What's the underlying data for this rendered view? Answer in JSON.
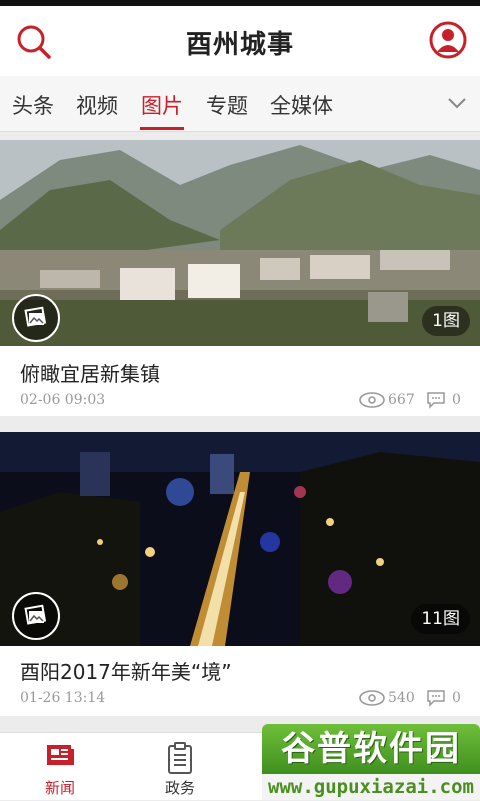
{
  "header": {
    "title": "酉州城事"
  },
  "tabs": [
    {
      "label": "头条"
    },
    {
      "label": "视频"
    },
    {
      "label": "图片"
    },
    {
      "label": "专题"
    },
    {
      "label": "全媒体"
    }
  ],
  "active_tab": "图片",
  "colors": {
    "accent": "#c8202a"
  },
  "cards": [
    {
      "title": "俯瞰宜居新集镇",
      "date": "02-06 09:03",
      "image_count": "1图",
      "views": "667",
      "comments": "0"
    },
    {
      "title": "酉阳2017年新年美“境”",
      "date": "01-26 13:14",
      "image_count": "11图",
      "views": "540",
      "comments": "0"
    }
  ],
  "bottom_nav": [
    {
      "label": "新闻",
      "icon": "newspaper-icon"
    },
    {
      "label": "政务",
      "icon": "clipboard-icon"
    }
  ],
  "watermark": {
    "name": "谷普软件园",
    "url": "www.gupuxiazai.com"
  }
}
